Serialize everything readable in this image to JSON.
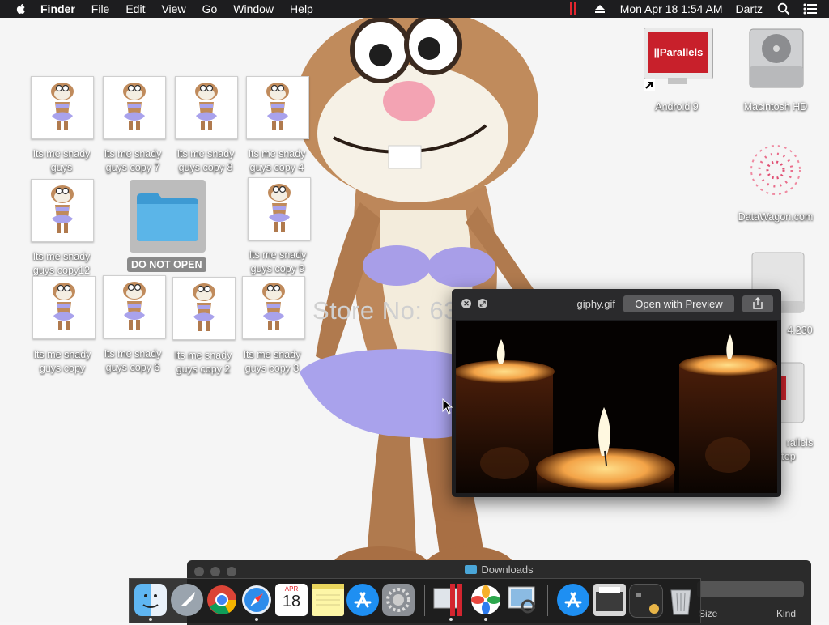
{
  "menubar": {
    "app": "Finder",
    "menus": [
      "File",
      "Edit",
      "View",
      "Go",
      "Window",
      "Help"
    ],
    "clock": "Mon Apr 18  1:54 AM",
    "user": "Dartz"
  },
  "wallpaper": {
    "watermark": "Store No: 63"
  },
  "desktop_icons": {
    "item_1": "Its me snady guys",
    "item_2": "Its me snady guys copy 7",
    "item_3": "Its me snady guys copy 8",
    "item_4": "Its me snady guys copy 4",
    "item_5": "Its me snady guys copy12",
    "folder": "DO NOT OPEN",
    "item_6": "Its me snady guys copy 9",
    "item_7": "Its me snady guys copy",
    "item_8": "Its me snady guys copy 6",
    "item_9": "Its me snady guys copy 2",
    "item_10": "Its me snady guys copy 3",
    "android": "Android 9",
    "parallels_logo": "||Parallels",
    "mac_hd": "Macintosh HD",
    "datawagon": "DataWagon.com",
    "drive_partial": "4.230",
    "parallels_partial_1": "rallels",
    "parallels_partial_2": "top"
  },
  "quicklook": {
    "filename": "giphy.gif",
    "open_button": "Open with Preview"
  },
  "downloads": {
    "title": "Downloads",
    "col_size": "Size",
    "col_kind": "Kind"
  },
  "dock": {
    "calendar_month": "APR",
    "calendar_day": "18"
  }
}
